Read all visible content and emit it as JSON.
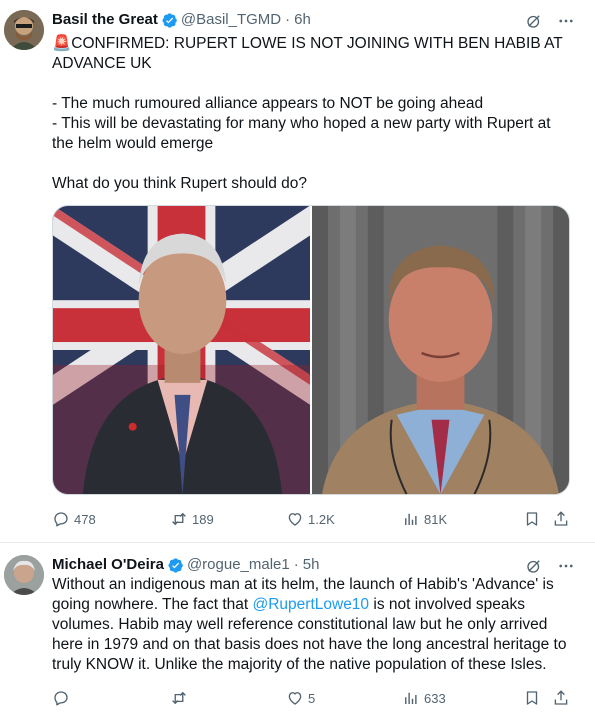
{
  "tweets": [
    {
      "author": {
        "name": "Basil the Great",
        "handle": "@Basil_TGMD",
        "time": "6h"
      },
      "lines": [
        "🚨CONFIRMED: RUPERT LOWE IS NOT JOINING WITH BEN HABIB AT ADVANCE UK",
        "- The much rumoured alliance appears to NOT be going ahead",
        "- This will be devastating for many who hoped a new party with Rupert at the helm would emerge",
        "What do you think Rupert should do?"
      ],
      "stats": {
        "replies": "478",
        "reposts": "189",
        "likes": "1.2K",
        "views": "81K"
      }
    },
    {
      "author": {
        "name": "Michael O'Deira",
        "handle": "@rogue_male1",
        "time": "5h"
      },
      "text_before": "Without an indigenous man at its helm, the launch of Habib's 'Advance' is going nowhere. The fact that ",
      "mention": "@RupertLowe10",
      "text_after": " is not involved speaks volumes. Habib may well reference constitutional law but he only arrived here in 1979 and on that basis does not have the long ancestral heritage to truly KNOW it. Unlike the majority of the native population of these Isles.",
      "stats": {
        "replies": "",
        "reposts": "",
        "likes": "5",
        "views": "633"
      }
    }
  ],
  "colors": {
    "text": "#0f1419",
    "secondary": "#536471",
    "link": "#1d9bf0",
    "verified": "#1d9bf0"
  }
}
